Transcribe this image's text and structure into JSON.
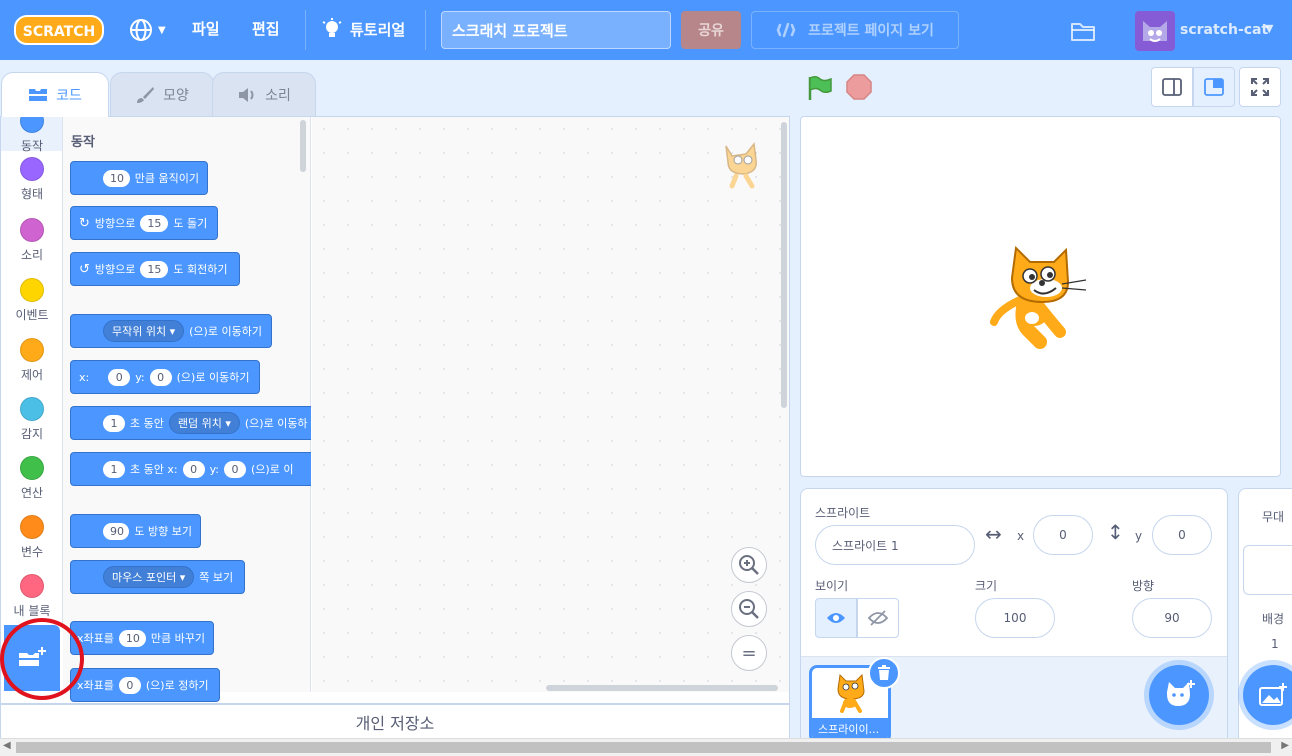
{
  "menubar": {
    "logo_text": "SCRATCH",
    "file": "파일",
    "edit": "편집",
    "tutorials": "튜토리얼",
    "project_title": "스크래치 프로젝트",
    "share": "공유",
    "see_project_page": "프로젝트 페이지 보기",
    "username": "scratch-cat"
  },
  "tabs": {
    "code": "코드",
    "costumes": "모양",
    "sounds": "소리"
  },
  "categories": [
    {
      "label": "동작",
      "color": "#4c97ff"
    },
    {
      "label": "형태",
      "color": "#9966ff"
    },
    {
      "label": "소리",
      "color": "#cf63cf"
    },
    {
      "label": "이벤트",
      "color": "#ffd500"
    },
    {
      "label": "제어",
      "color": "#ffab19"
    },
    {
      "label": "감지",
      "color": "#4cbfe6"
    },
    {
      "label": "연산",
      "color": "#40bf4a"
    },
    {
      "label": "변수",
      "color": "#ff8c1a"
    },
    {
      "label": "내 블록",
      "color": "#ff6680"
    }
  ],
  "palette": {
    "section": "동작",
    "b1": {
      "v": "10",
      "t": "만큼 움직이기"
    },
    "b2": {
      "a": "방향으로",
      "v": "15",
      "t": "도 돌기"
    },
    "b3": {
      "a": "방향으로",
      "v": "15",
      "t": "도 회전하기"
    },
    "b4": {
      "d": "무작위 위치",
      "t": "(으)로 이동하기"
    },
    "b5": {
      "x": "x:",
      "xv": "0",
      "y": "y:",
      "yv": "0",
      "t": "(으)로 이동하기"
    },
    "b6": {
      "v": "1",
      "a": "초 동안",
      "d": "랜덤 위치",
      "t": "(으)로 이동하"
    },
    "b7": {
      "v": "1",
      "a": "초 동안 x:",
      "xv": "0",
      "y": "y:",
      "yv": "0",
      "t": "(으)로 이"
    },
    "b8": {
      "v": "90",
      "t": "도 방향 보기"
    },
    "b9": {
      "d": "마우스 포인터",
      "t": "쪽 보기"
    },
    "b10": {
      "a": "x좌표를",
      "v": "10",
      "t": "만큼 바꾸기"
    },
    "b11": {
      "a": "x좌표를",
      "v": "0",
      "t": "(으)로 정하기"
    }
  },
  "zoom": {
    "in": "+",
    "out": "−",
    "reset": "="
  },
  "backpack": "개인 저장소",
  "sprite_info": {
    "sprite_label": "스프라이트",
    "sprite_name": "스프라이트 1",
    "x_label": "x",
    "x_value": "0",
    "y_label": "y",
    "y_value": "0",
    "show_label": "보이기",
    "size_label": "크기",
    "size_value": "100",
    "direction_label": "방향",
    "direction_value": "90"
  },
  "sprite_list": {
    "thumb_name": "스프라이이..."
  },
  "backdrop": {
    "stage_label": "무대",
    "backdrops_label": "배경",
    "backdrops_count": "1"
  }
}
